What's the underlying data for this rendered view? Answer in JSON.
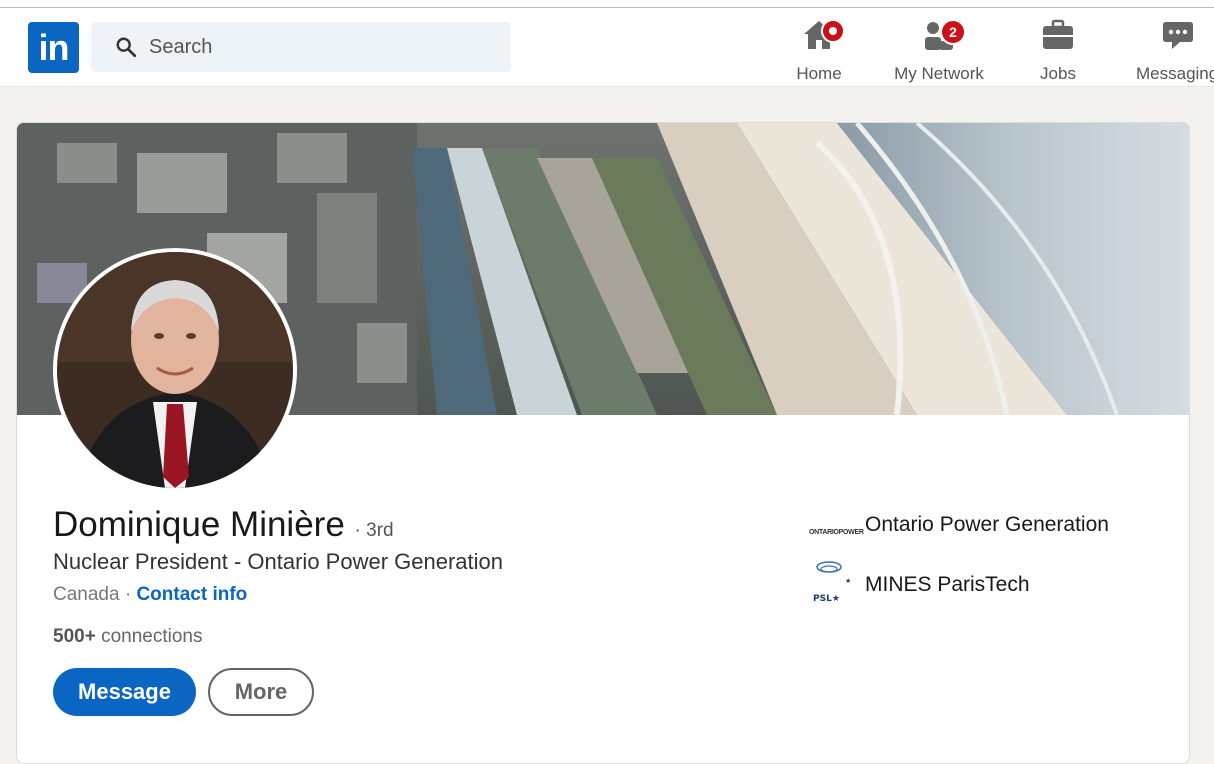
{
  "header": {
    "logo_text": "in",
    "search": {
      "placeholder": "Search"
    },
    "nav": [
      {
        "label": "Home",
        "icon": "home-icon",
        "badge": ""
      },
      {
        "label": "My Network",
        "icon": "people-icon",
        "badge": "2"
      },
      {
        "label": "Jobs",
        "icon": "briefcase-icon",
        "badge": ""
      },
      {
        "label": "Messaging",
        "icon": "chat-icon",
        "badge": ""
      }
    ]
  },
  "profile": {
    "name": "Dominique Minière",
    "degree": "· 3rd",
    "headline": "Nuclear President - Ontario Power Generation",
    "location": "Canada",
    "location_sep": " · ",
    "contact_info": "Contact info",
    "connections_count": "500+",
    "connections_label": " connections",
    "actions": {
      "message": "Message",
      "more": "More"
    },
    "affiliations": [
      {
        "name": "Ontario Power Generation",
        "logo_text": "ONTARIOPOWER"
      },
      {
        "name": "MINES ParisTech",
        "logo_text": "MINES ParisTech PSL"
      }
    ]
  },
  "colors": {
    "brand": "#0a66c2",
    "notification": "#cc1016",
    "background": "#f3f2ef"
  }
}
